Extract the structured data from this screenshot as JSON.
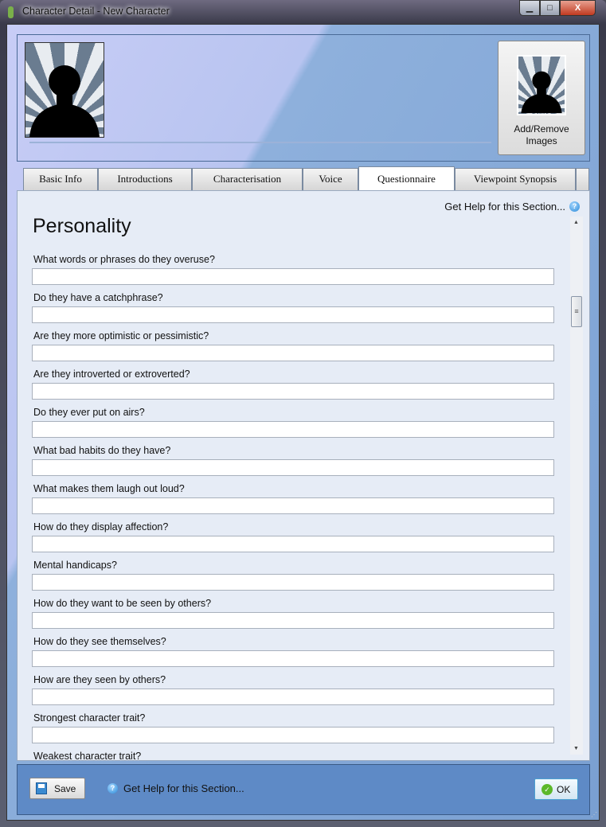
{
  "window": {
    "title": "Character Detail - New Character",
    "controls": {
      "minimize": "▁",
      "maximize": "□",
      "close": "X"
    }
  },
  "header": {
    "add_remove_label": "Add/Remove Images"
  },
  "tabs": [
    {
      "label": "Basic Info"
    },
    {
      "label": "Introductions"
    },
    {
      "label": "Characterisation"
    },
    {
      "label": "Voice"
    },
    {
      "label": "Questionnaire",
      "active": true
    },
    {
      "label": "Viewpoint Synopsis"
    }
  ],
  "content": {
    "help_link": "Get Help for this Section...",
    "section_title": "Personality",
    "questions": [
      {
        "label": "What words or phrases do they overuse?",
        "value": ""
      },
      {
        "label": "Do they have a catchphrase?",
        "value": ""
      },
      {
        "label": "Are they more optimistic or pessimistic?",
        "value": ""
      },
      {
        "label": "Are they introverted or extroverted?",
        "value": ""
      },
      {
        "label": "Do they ever put on airs?",
        "value": ""
      },
      {
        "label": "What bad habits do they have?",
        "value": ""
      },
      {
        "label": "What makes them laugh out loud?",
        "value": ""
      },
      {
        "label": "How do they display affection?",
        "value": ""
      },
      {
        "label": "Mental handicaps?",
        "value": ""
      },
      {
        "label": "How do they want to be seen by others?",
        "value": ""
      },
      {
        "label": "How do they see themselves?",
        "value": ""
      },
      {
        "label": "How are they seen by others?",
        "value": ""
      },
      {
        "label": "Strongest character trait?",
        "value": ""
      },
      {
        "label": "Weakest character trait?",
        "value": ""
      }
    ]
  },
  "footer": {
    "save_label": "Save",
    "help_link": "Get Help for this Section...",
    "ok_label": "OK"
  },
  "icons": {
    "help": "question-circle-icon",
    "save": "floppy-disk-icon",
    "ok": "check-circle-icon"
  }
}
